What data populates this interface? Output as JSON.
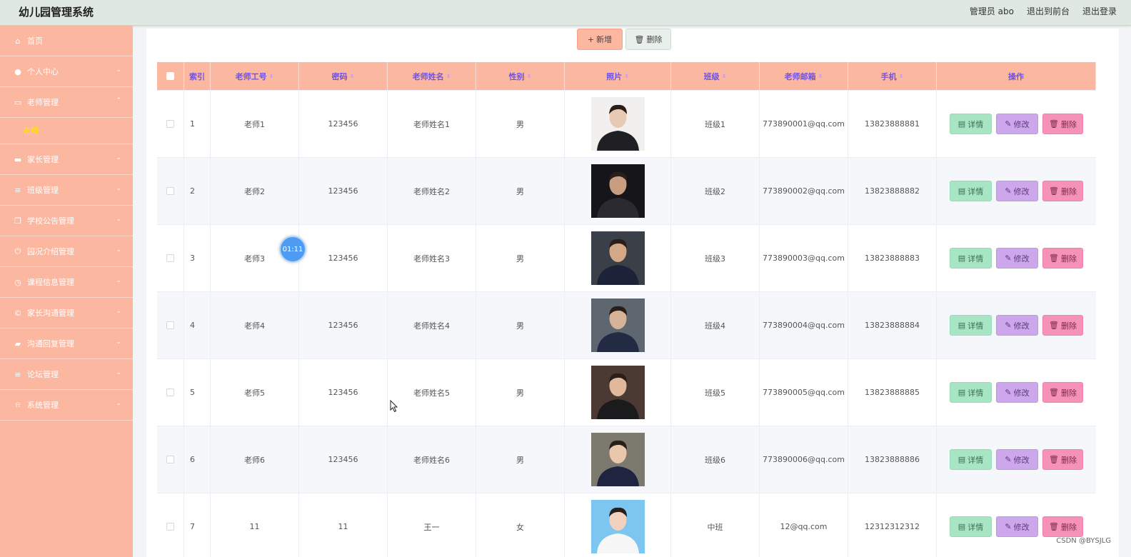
{
  "header": {
    "title": "幼儿园管理系统",
    "links": [
      "管理员 abo",
      "退出到前台",
      "退出登录"
    ]
  },
  "sidebar": {
    "items": [
      {
        "label": "首页",
        "icon": "home-icon",
        "glyph": "⌂",
        "chev": ""
      },
      {
        "label": "个人中心",
        "icon": "user-icon",
        "glyph": "●",
        "chev": "⌄"
      },
      {
        "label": "老师管理",
        "icon": "chat-icon",
        "glyph": "▭",
        "chev": "⌃"
      },
      {
        "label": "家长管理",
        "icon": "monitor-icon",
        "glyph": "▬",
        "chev": "⌄"
      },
      {
        "label": "班级管理",
        "icon": "list-icon",
        "glyph": "≡",
        "chev": "⌄"
      },
      {
        "label": "学校公告管理",
        "icon": "copy-icon",
        "glyph": "❐",
        "chev": "⌄"
      },
      {
        "label": "园况介绍管理",
        "icon": "power-icon",
        "glyph": "⏻",
        "chev": "⌄"
      },
      {
        "label": "课程信息管理",
        "icon": "clock-icon",
        "glyph": "◷",
        "chev": "⌄"
      },
      {
        "label": "家长沟通管理",
        "icon": "copyright-icon",
        "glyph": "©",
        "chev": "⌄"
      },
      {
        "label": "沟通回复管理",
        "icon": "briefcase-icon",
        "glyph": "▰",
        "chev": "⌄"
      },
      {
        "label": "论坛管理",
        "icon": "list-icon",
        "glyph": "≡",
        "chev": "⌄"
      },
      {
        "label": "系统管理",
        "icon": "bell-off-icon",
        "glyph": "⍾",
        "chev": "⌄"
      }
    ],
    "submenu_label": "老师"
  },
  "toolbar": {
    "add_label": "新增",
    "delete_label": "删除"
  },
  "table": {
    "headers": [
      "索引",
      "老师工号",
      "密码",
      "老师姓名",
      "性别",
      "照片",
      "班级",
      "老师邮箱",
      "手机",
      "操作"
    ],
    "rows": [
      {
        "index": "1",
        "id": "老师1",
        "password": "123456",
        "name": "老师姓名1",
        "gender": "男",
        "class": "班级1",
        "email": "773890001@qq.com",
        "phone": "13823888881"
      },
      {
        "index": "2",
        "id": "老师2",
        "password": "123456",
        "name": "老师姓名2",
        "gender": "男",
        "class": "班级2",
        "email": "773890002@qq.com",
        "phone": "13823888882"
      },
      {
        "index": "3",
        "id": "老师3",
        "password": "123456",
        "name": "老师姓名3",
        "gender": "男",
        "class": "班级3",
        "email": "773890003@qq.com",
        "phone": "13823888883"
      },
      {
        "index": "4",
        "id": "老师4",
        "password": "123456",
        "name": "老师姓名4",
        "gender": "男",
        "class": "班级4",
        "email": "773890004@qq.com",
        "phone": "13823888884"
      },
      {
        "index": "5",
        "id": "老师5",
        "password": "123456",
        "name": "老师姓名5",
        "gender": "男",
        "class": "班级5",
        "email": "773890005@qq.com",
        "phone": "13823888885"
      },
      {
        "index": "6",
        "id": "老师6",
        "password": "123456",
        "name": "老师姓名6",
        "gender": "男",
        "class": "班级6",
        "email": "773890006@qq.com",
        "phone": "13823888886"
      },
      {
        "index": "7",
        "id": "11",
        "password": "11",
        "name": "王一",
        "gender": "女",
        "class": "中班",
        "email": "12@qq.com",
        "phone": "12312312312"
      }
    ],
    "row_actions": {
      "detail": "详情",
      "edit": "修改",
      "delete": "删除"
    }
  },
  "overlay": {
    "timer": "01:11",
    "watermark": "CSDN @BYSJLG"
  },
  "colors": {
    "accent": "#fcb7a0",
    "header_bg": "#dfe9e2",
    "header_text": "#6f52e6",
    "submenu_active": "#ffe600"
  }
}
